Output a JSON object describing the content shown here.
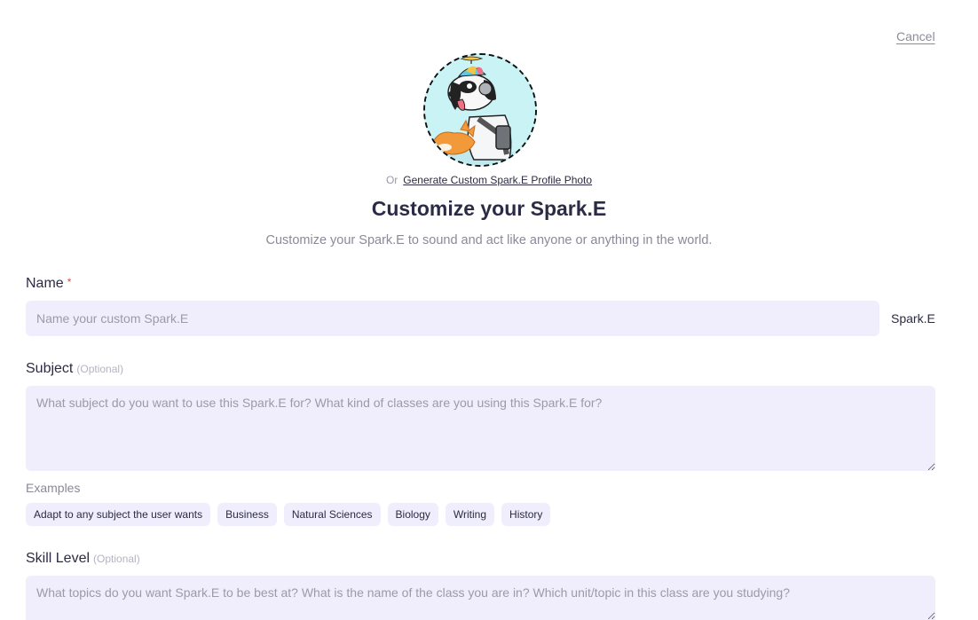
{
  "cancel_label": "Cancel",
  "avatar": {
    "icon": "robot-dog-avatar",
    "colors": {
      "background": "#c9f3f4",
      "border": "#111111"
    }
  },
  "generate": {
    "or_text": "Or",
    "link_label": "Generate Custom Spark.E Profile Photo"
  },
  "title": "Customize your Spark.E",
  "subtitle": "Customize your Spark.E to sound and act like anyone or anything in the world.",
  "name_field": {
    "label": "Name",
    "required_mark": "*",
    "placeholder": "Name your custom Spark.E",
    "value": "",
    "suffix": "Spark.E"
  },
  "subject_field": {
    "label": "Subject",
    "optional_text": "(Optional)",
    "placeholder": "What subject do you want to use this Spark.E for? What kind of classes are you using this Spark.E for?",
    "value": ""
  },
  "examples": {
    "label": "Examples",
    "items": [
      "Adapt to any subject the user wants",
      "Business",
      "Natural Sciences",
      "Biology",
      "Writing",
      "History"
    ]
  },
  "skill_field": {
    "label": "Skill Level",
    "optional_text": "(Optional)",
    "placeholder": "What topics do you want Spark.E to be best at? What is the name of the class you are in? Which unit/topic in this class are you studying?",
    "value": ""
  },
  "colors": {
    "input_bg": "#f0eefc",
    "text": "#2b2b45",
    "muted": "#8a8a99",
    "required": "#e0453c"
  }
}
